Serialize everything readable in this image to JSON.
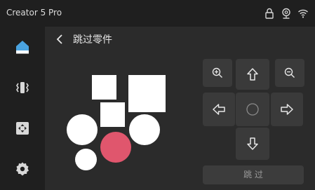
{
  "app": {
    "title": "Creator 5 Pro"
  },
  "page": {
    "title": "跳过零件"
  },
  "buttons": {
    "skip_label": "跳 过"
  },
  "icons": {
    "status": [
      "lock-icon",
      "webcam-icon",
      "wifi-icon"
    ],
    "sidebar": [
      "home-icon",
      "vibration-icon",
      "move-icon",
      "settings-icon"
    ],
    "controls": [
      "zoom-in-icon",
      "arrow-up-icon",
      "zoom-out-icon",
      "arrow-left-icon",
      "center-icon",
      "arrow-right-icon",
      "arrow-down-icon"
    ]
  },
  "colors": {
    "accent": "#4aa3e0",
    "selected_part": "#e0566d",
    "part": "#ffffff",
    "background": "#2b2b2b",
    "panel": "#1f1f1f",
    "button": "#3a3a3a"
  },
  "parts": [
    {
      "shape": "square",
      "selected": false
    },
    {
      "shape": "square",
      "selected": false
    },
    {
      "shape": "square",
      "selected": false
    },
    {
      "shape": "circle",
      "selected": false
    },
    {
      "shape": "circle",
      "selected": true
    },
    {
      "shape": "circle",
      "selected": false
    },
    {
      "shape": "circle",
      "selected": false
    }
  ]
}
